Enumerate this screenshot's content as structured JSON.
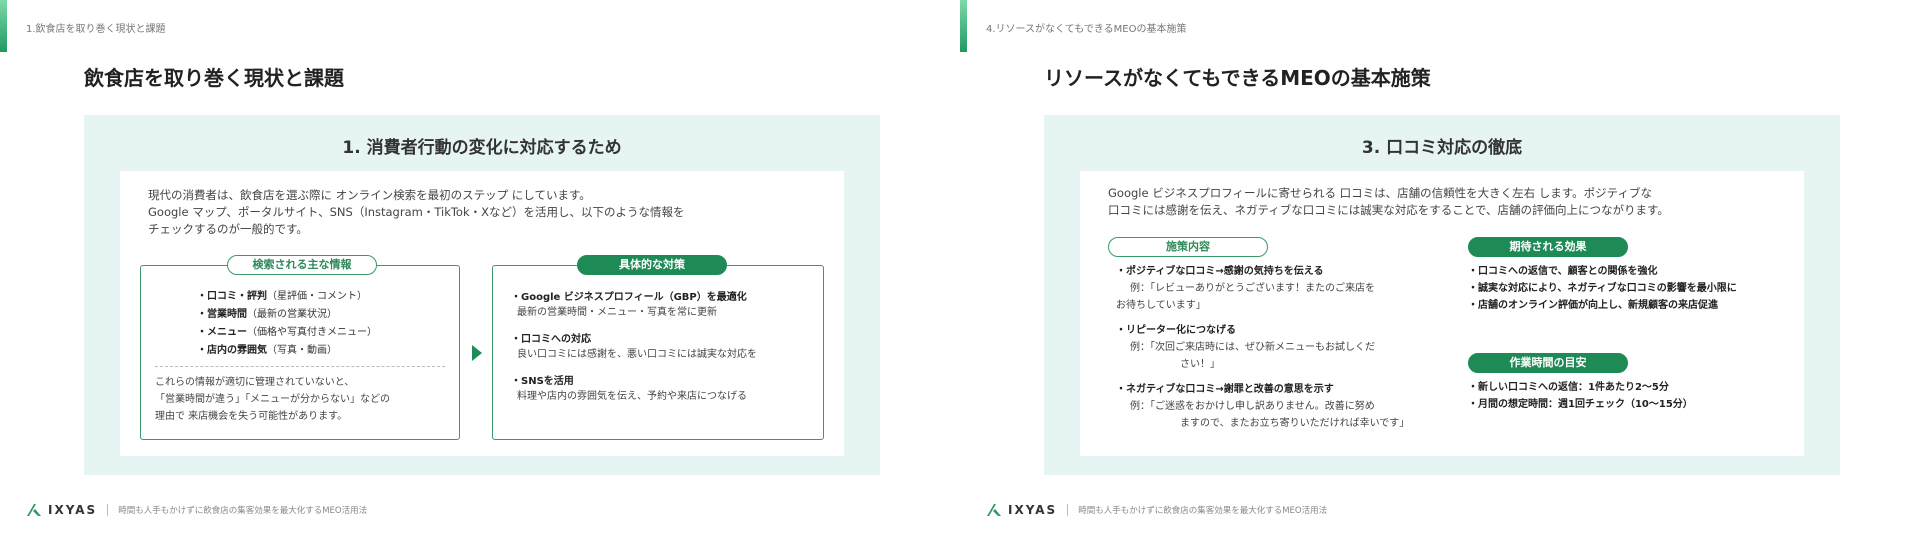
{
  "slide1": {
    "breadcrumb": "1.飲食店を取り巻く現状と課題",
    "title": "飲食店を取り巻く現状と課題",
    "panel_title": "1. 消費者行動の変化に対応するため",
    "intro": [
      "現代の消費者は、飲食店を選ぶ際に オンライン検索を最初のステップ にしています。",
      "Google マップ、ポータルサイト、SNS（Instagram・TikTok・Xなど）を活用し、以下のような情報を",
      "チェックするのが一般的です。"
    ],
    "left_box": {
      "title": "検索される主な情報",
      "items": [
        {
          "bold": "・口コミ・評判",
          "rest": "（星評価・コメント）"
        },
        {
          "bold": "・営業時間",
          "rest": "（最新の営業状況）"
        },
        {
          "bold": "・メニュー",
          "rest": "（価格や写真付きメニュー）"
        },
        {
          "bold": "・店内の雰囲気",
          "rest": "（写真・動画）"
        }
      ],
      "note": [
        "これらの情報が適切に管理されていないと、",
        "「営業時間が違う」「メニューが分からない」などの",
        "理由で 来店機会を失う可能性があります。"
      ]
    },
    "right_box": {
      "title": "具体的な対策",
      "measures": [
        {
          "title": "・Google ビジネスプロフィール（GBP）を最適化",
          "desc": "最新の営業時間・メニュー・写真を常に更新"
        },
        {
          "title": "・口コミへの対応",
          "desc": "良い口コミには感謝を、悪い口コミには誠実な対応を"
        },
        {
          "title": "・SNSを活用",
          "desc": "料理や店内の雰囲気を伝え、予約や来店につなげる"
        }
      ]
    }
  },
  "slide2": {
    "breadcrumb": "4.リソースがなくてもできるMEOの基本施策",
    "title": "リソースがなくてもできるMEOの基本施策",
    "panel_title": "3. 口コミ対応の徹底",
    "intro": [
      "Google ビジネスプロフィールに寄せられる 口コミは、店舗の信頼性を大きく左右 します。ポジティブな",
      "口コミには感謝を伝え、ネガティブな口コミには誠実な対応をすることで、店舗の評価向上につながります。"
    ],
    "left_col": {
      "title": "施策内容",
      "items": [
        {
          "item": "・ポジティブな口コミ→感謝の気持ちを伝える",
          "ex": [
            "例：「レビューありがとうございます！またのご来店を",
            "お待ちしています」"
          ]
        },
        {
          "item": "・リピーター化につなげる",
          "ex": [
            "例：「次回ご来店時には、ぜひ新メニューもお試しくだ",
            "さい！」"
          ]
        },
        {
          "item": "・ネガティブな口コミ→謝罪と改善の意思を示す",
          "ex": [
            "例：「ご迷惑をおかけし申し訳ありません。改善に努め",
            "ますので、またお立ち寄りいただければ幸いです」"
          ]
        }
      ]
    },
    "effects": {
      "title": "期待される効果",
      "items": [
        "・口コミへの返信で、顧客との関係を強化",
        "・誠実な対応により、ネガティブな口コミの影響を最小限に",
        "・店舗のオンライン評価が向上し、新規顧客の来店促進"
      ]
    },
    "time": {
      "title": "作業時間の目安",
      "items": [
        "・新しい口コミへの返信：1件あたり2〜5分",
        "・月間の想定時間：週1回チェック（10〜15分）"
      ]
    }
  },
  "footer": {
    "logo_text": "IXYAS",
    "tagline": "時間も人手もかけずに飲食店の集客効果を最大化するMEO活用法"
  },
  "colors": {
    "accent_green": "#1e8a56",
    "panel_bg": "#e6f5f4"
  }
}
